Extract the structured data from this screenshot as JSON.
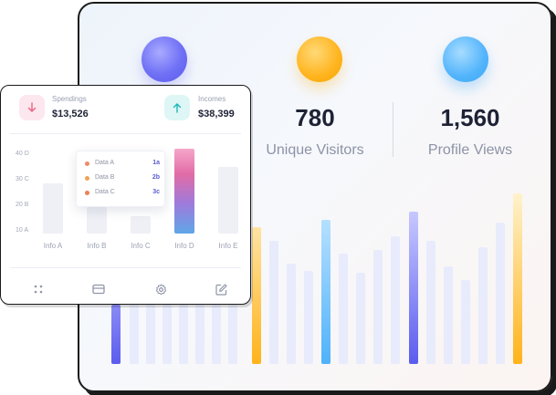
{
  "stats": [
    {
      "value": "780",
      "label": "Unique Visitors"
    },
    {
      "value": "1,560",
      "label": "Profile Views"
    }
  ],
  "kpis": {
    "spendings": {
      "label": "Spendings",
      "amount": "$13,526",
      "icon": "arrow-down-icon"
    },
    "incomes": {
      "label": "Incomes",
      "amount": "$38,399",
      "icon": "arrow-up-icon"
    }
  },
  "mini_chart": {
    "y_ticks": [
      "40 D",
      "30 C",
      "20 B",
      "10 A"
    ],
    "categories": [
      "Info A",
      "Info B",
      "Info C",
      "Info D",
      "Info E"
    ]
  },
  "tooltip": [
    {
      "label": "Data A",
      "value": "1a",
      "color": "#f08a6a"
    },
    {
      "label": "Data B",
      "value": "2b",
      "color": "#f0a35a"
    },
    {
      "label": "Data C",
      "value": "3c",
      "color": "#ef7e56"
    }
  ],
  "footer_icons": [
    "grid-icon",
    "card-icon",
    "gear-icon",
    "edit-icon"
  ],
  "colors": {
    "purple": "#6b6cf2",
    "orange": "#ffb31a",
    "blue": "#4fb2fa",
    "lavender": "#e8ebfb"
  }
}
